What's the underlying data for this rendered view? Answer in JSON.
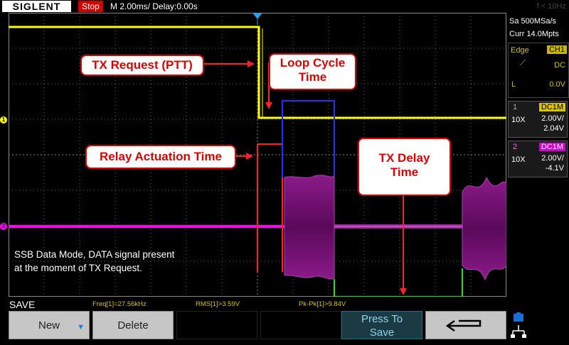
{
  "header": {
    "brand": "SIGLENT",
    "run_state": "Stop",
    "timebase": "M 2.00ms/ Delay:0.00s",
    "trigger_freq": "f < 10Hz"
  },
  "side": {
    "sample_rate": "Sa 500MSa/s",
    "memory": "Curr 14.0Mpts",
    "trigger": {
      "label": "Edge",
      "source": "CH1",
      "coupling": "DC",
      "level_label": "L",
      "level": "0.0V"
    },
    "channels": [
      {
        "num": "1",
        "coupling": "DC1M",
        "probe": "10X",
        "scale": "2.00V/",
        "offset": "2.04V",
        "color": "#ffff00"
      },
      {
        "num": "2",
        "coupling": "DC1M",
        "probe": "10X",
        "scale": "2.00V/",
        "offset": "-4.1V",
        "color": "#ff00ff"
      }
    ]
  },
  "markers": {
    "ch1": "1",
    "ch2": "2"
  },
  "annotations": {
    "tx_request": "TX Request (PTT)",
    "loop_cycle_1": "Loop Cycle",
    "loop_cycle_2": "Time",
    "relay_actuation": "Relay Actuation Time",
    "tx_delay_1": "TX Delay",
    "tx_delay_2": "Time",
    "note_1": "SSB Data Mode, DATA signal present",
    "note_2": "at the moment of TX Request."
  },
  "status": {
    "mode": "SAVE",
    "freq": "Freq[1]=27.56kHz",
    "rms": "RMS[1]>3.59V",
    "pkpk": "Pk-Pk[1]>9.84V"
  },
  "softkeys": {
    "new": "New",
    "delete": "Delete",
    "press_to_1": "Press To",
    "press_to_2": "Save"
  }
}
